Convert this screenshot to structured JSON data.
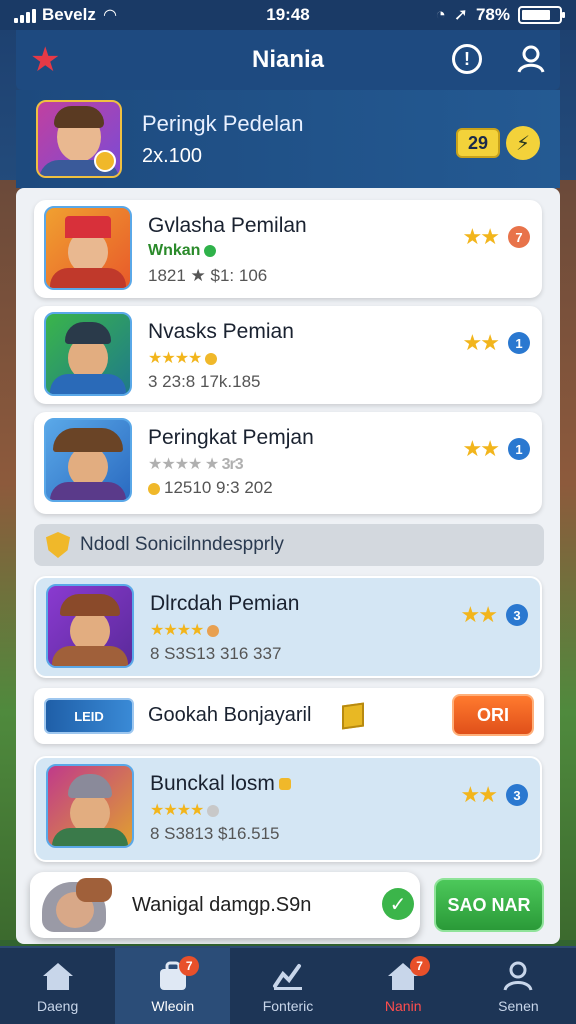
{
  "status_bar": {
    "carrier": "Bevelz",
    "time": "19:48",
    "battery": "78%"
  },
  "header": {
    "title": "Nianiа"
  },
  "profile": {
    "name": "Peringk Pedelan",
    "score": "2x.100",
    "badge": "29"
  },
  "players": [
    {
      "title": "Gvlasha Pemilan",
      "sub": "Wnkan",
      "stats": "1821 ★ $1: 106",
      "rank": "7",
      "rank_color": "#e8734a",
      "stars": "★★",
      "highlight": false
    },
    {
      "title": "Nvasks Pemian",
      "sub": "★★★★",
      "stats": "3 23:8 17k.185",
      "rank": "1",
      "rank_color": "#2a78d0",
      "stars": "★★",
      "highlight": false
    },
    {
      "title": "Peringkat Pemjan",
      "sub": "★★★★ ★ 3r3",
      "stats": "12510 9:3 202",
      "rank": "1",
      "rank_color": "#2a78d0",
      "stars": "★★",
      "highlight": false
    }
  ],
  "section": {
    "label": "Ndodl Sonicilnndespprly"
  },
  "players_lower": [
    {
      "title": "Dlrcdah Pemian",
      "sub": "★★★★",
      "stats": "8 S3S13 316 337",
      "rank": "3",
      "rank_color": "#2a78d0",
      "stars": "★★",
      "highlight": true
    },
    {
      "title": "Bunckal losm",
      "sub": "★★★★",
      "stats": "8 S3813 $16.515",
      "rank": "3",
      "rank_color": "#2a78d0",
      "stars": "★★",
      "highlight": true
    }
  ],
  "banner": {
    "logo": "LEID",
    "text": "Gookah Bonjayaril",
    "button": "ORI"
  },
  "toast": {
    "text": "Wanigal damgp.S9n",
    "button": "SAO NAR"
  },
  "nav": [
    {
      "label": "Daeng",
      "badge": ""
    },
    {
      "label": "Wleoin",
      "badge": "7"
    },
    {
      "label": "Fonteric",
      "badge": ""
    },
    {
      "label": "Nanin",
      "badge": "7"
    },
    {
      "label": "Senen",
      "badge": ""
    }
  ]
}
